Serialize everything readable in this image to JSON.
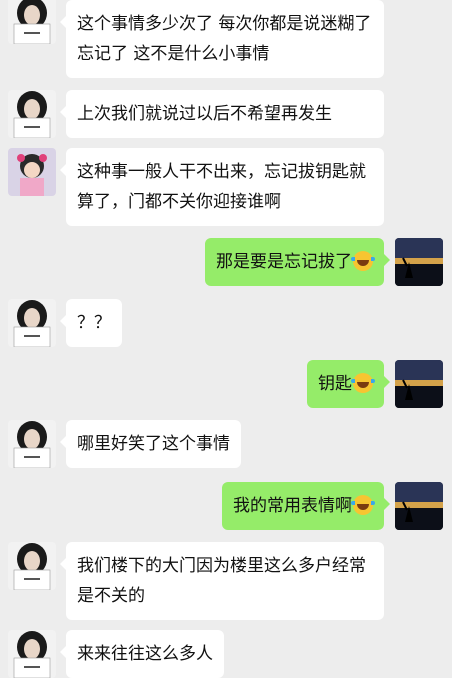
{
  "messages": [
    {
      "side": "in",
      "avatar": "girl-avatar-icon",
      "text": "这个事情多少次了 每次你都是说迷糊了 忘记了 这不是什么小事情"
    },
    {
      "side": "in",
      "avatar": "girl-avatar-icon",
      "text": "上次我们就说过以后不希望再发生"
    },
    {
      "side": "in",
      "avatar": "child-avatar-icon",
      "text": "这种事一般人干不出来，忘记拔钥匙就算了，门都不关你迎接谁啊"
    },
    {
      "side": "out",
      "avatar": "sunset-avatar-icon",
      "text": "那是要是忘记拔了",
      "emoji": "tears-of-joy-emoji"
    },
    {
      "side": "in",
      "avatar": "girl-avatar-icon",
      "text": "？？"
    },
    {
      "side": "out",
      "avatar": "sunset-avatar-icon",
      "text": "钥匙",
      "emoji": "tears-of-joy-emoji"
    },
    {
      "side": "in",
      "avatar": "girl-avatar-icon",
      "text": "哪里好笑了这个事情"
    },
    {
      "side": "out",
      "avatar": "sunset-avatar-icon",
      "text": "我的常用表情啊",
      "emoji": "tears-of-joy-emoji"
    },
    {
      "side": "in",
      "avatar": "girl-avatar-icon",
      "text": "我们楼下的大门因为楼里这么多户经常是不关的"
    },
    {
      "side": "in",
      "avatar": "girl-avatar-icon",
      "text": "来来往往这么多人"
    }
  ],
  "colors": {
    "background": "#ededed",
    "incoming_bubble": "#ffffff",
    "outgoing_bubble": "#95ec69"
  }
}
